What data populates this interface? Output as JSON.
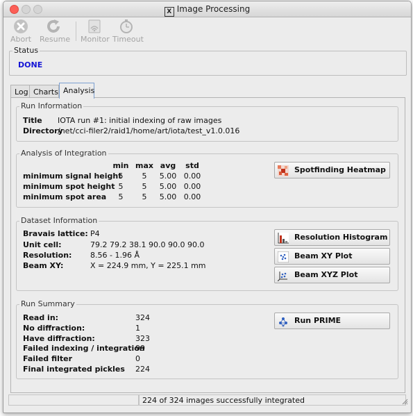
{
  "window": {
    "title": "Image Processing"
  },
  "toolbar": {
    "abort_label": "Abort",
    "resume_label": "Resume",
    "monitor_label": "Monitor",
    "timeout_label": "Timeout"
  },
  "status": {
    "legend": "Status",
    "value": "DONE",
    "value_color": "#1414d6"
  },
  "tabs": [
    {
      "label": "Log",
      "active": false
    },
    {
      "label": "Charts",
      "active": false
    },
    {
      "label": "Analysis",
      "active": true
    }
  ],
  "run_info": {
    "legend": "Run Information",
    "title_label": "Title",
    "title_value": "IOTA run #1: initial indexing of raw images",
    "directory_label": "Directory",
    "directory_value": "/net/cci-filer2/raid1/home/art/iota/test_v1.0.016"
  },
  "integration": {
    "legend": "Analysis of Integration",
    "columns": [
      "min",
      "max",
      "avg",
      "std"
    ],
    "rows": [
      {
        "label": "minimum signal height",
        "values": [
          "5",
          "5",
          "5.00",
          "0.00"
        ]
      },
      {
        "label": "minimum spot height",
        "values": [
          "5",
          "5",
          "5.00",
          "0.00"
        ]
      },
      {
        "label": "minimum spot area",
        "values": [
          "5",
          "5",
          "5.00",
          "0.00"
        ]
      }
    ],
    "heatmap_button": "Spotfinding Heatmap"
  },
  "dataset": {
    "legend": "Dataset Information",
    "rows": [
      {
        "label": "Bravais lattice:",
        "value": "P4"
      },
      {
        "label": "Unit cell:",
        "value": "79.2 79.2 38.1 90.0 90.0 90.0"
      },
      {
        "label": "Resolution:",
        "value": "8.56 - 1.96 Å"
      },
      {
        "label": "Beam XY:",
        "value": "X = 224.9 mm, Y = 225.1 mm"
      }
    ],
    "buttons": {
      "histogram": "Resolution Histogram",
      "beam_xy": "Beam XY Plot",
      "beam_xyz": "Beam XYZ Plot"
    }
  },
  "summary": {
    "legend": "Run Summary",
    "rows": [
      {
        "label": "Read in:",
        "value": "324"
      },
      {
        "label": "No diffraction:",
        "value": "1"
      },
      {
        "label": "Have diffraction:",
        "value": "323"
      },
      {
        "label": "Failed indexing / integration",
        "value": "99"
      },
      {
        "label": "Failed filter",
        "value": "0"
      },
      {
        "label": "Final integrated pickles",
        "value": "224"
      }
    ],
    "prime_button": "Run PRIME"
  },
  "statusbar": {
    "text": "224 of 324 images successfully integrated"
  }
}
